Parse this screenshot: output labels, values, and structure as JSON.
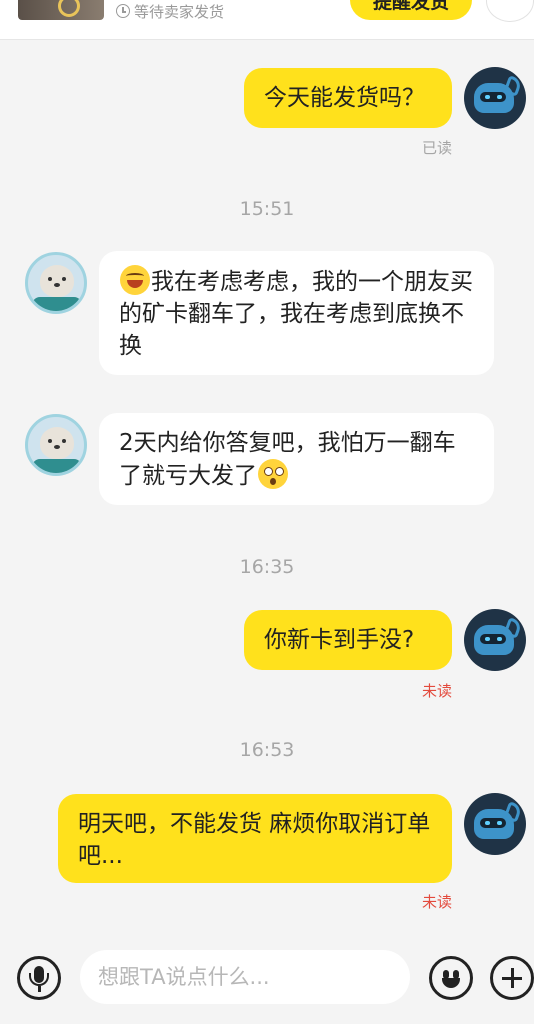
{
  "order": {
    "status_text": "等待卖家发货",
    "remind_label": "提醒发货",
    "status_icon": "clock-icon"
  },
  "messages": [
    {
      "from": "me",
      "text": "今天能发货吗？",
      "status": "已读"
    },
    {
      "type": "time",
      "text": "15:51"
    },
    {
      "from": "other",
      "emoji_start": "laugh-cry-emoji",
      "text": "我在考虑考虑，我的一个朋友买的矿卡翻车了，我在考虑到底换不换"
    },
    {
      "from": "other",
      "text": "2天内给你答复吧，我怕万一翻车了就亏大发了",
      "emoji_end": "astonished-emoji"
    },
    {
      "type": "time",
      "text": "16:35"
    },
    {
      "from": "me",
      "text": "你新卡到手没?",
      "status": "未读"
    },
    {
      "type": "time",
      "text": "16:53"
    },
    {
      "from": "me",
      "text": "明天吧，不能发货 麻烦你取消订单吧...",
      "status": "未读"
    }
  ],
  "input_bar": {
    "placeholder": "想跟TA说点什么...",
    "voice_icon": "microphone-icon",
    "emoji_icon": "smiley-icon",
    "more_icon": "plus-icon"
  },
  "colors": {
    "my_bubble": "#ffe11c",
    "other_bubble": "#ffffff",
    "background": "#f4f4f4",
    "unread": "#e34a3d",
    "read": "#a6a6a6",
    "accent_button": "#ffe21a"
  }
}
